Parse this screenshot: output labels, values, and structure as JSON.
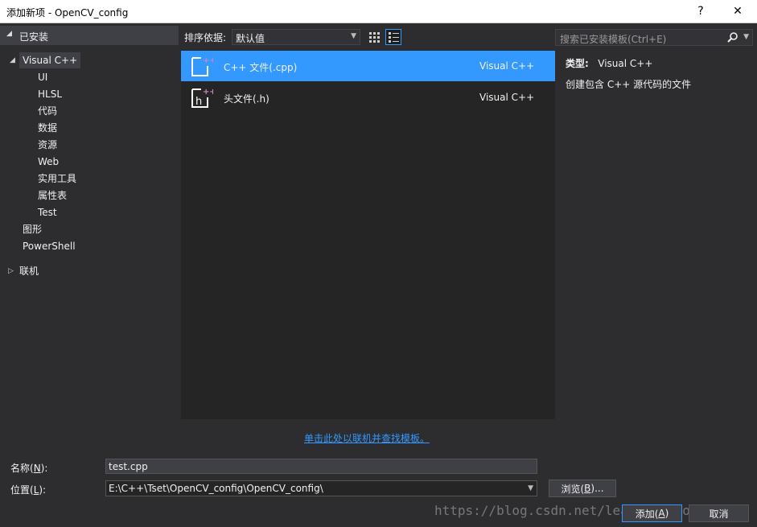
{
  "window": {
    "title": "添加新项 - OpenCV_config",
    "help": "?",
    "close": "✕"
  },
  "tree": {
    "header": "已安装",
    "items": [
      {
        "label": "Visual C++"
      },
      {
        "label": "UI"
      },
      {
        "label": "HLSL"
      },
      {
        "label": "代码"
      },
      {
        "label": "数据"
      },
      {
        "label": "资源"
      },
      {
        "label": "Web"
      },
      {
        "label": "实用工具"
      },
      {
        "label": "属性表"
      },
      {
        "label": "Test"
      },
      {
        "label": "图形"
      },
      {
        "label": "PowerShell"
      },
      {
        "label": "联机"
      }
    ]
  },
  "toolbar": {
    "sort_label": "排序依据:",
    "sort_value": "默认值",
    "search_placeholder": "搜索已安装模板(Ctrl+E)"
  },
  "templates": [
    {
      "name": "C++ 文件(.cpp)",
      "lang": "Visual C++",
      "selected": true
    },
    {
      "name": "头文件(.h)",
      "lang": "Visual C++",
      "selected": false
    }
  ],
  "details": {
    "type_label": "类型:",
    "type_value": "Visual C++",
    "description": "创建包含 C++ 源代码的文件"
  },
  "online_link": "单击此处以联机并查找模板。",
  "form": {
    "name_label_pre": "名称(",
    "name_label_key": "N",
    "name_label_post": "):",
    "name_value": "test.cpp",
    "location_label_pre": "位置(",
    "location_label_key": "L",
    "location_label_post": "):",
    "location_value": "E:\\C++\\Tset\\OpenCV_config\\OpenCV_config\\",
    "browse_pre": "浏览(",
    "browse_key": "B",
    "browse_post": ")...",
    "add_pre": "添加(",
    "add_key": "A",
    "add_post": ")",
    "cancel": "取消"
  },
  "watermark": "https://blog.csdn.net/learning_tortosie",
  "colors": {
    "background": "#2d2d30",
    "panel": "#252526",
    "selection": "#3399ff",
    "icon_accent": "#c586c0"
  }
}
